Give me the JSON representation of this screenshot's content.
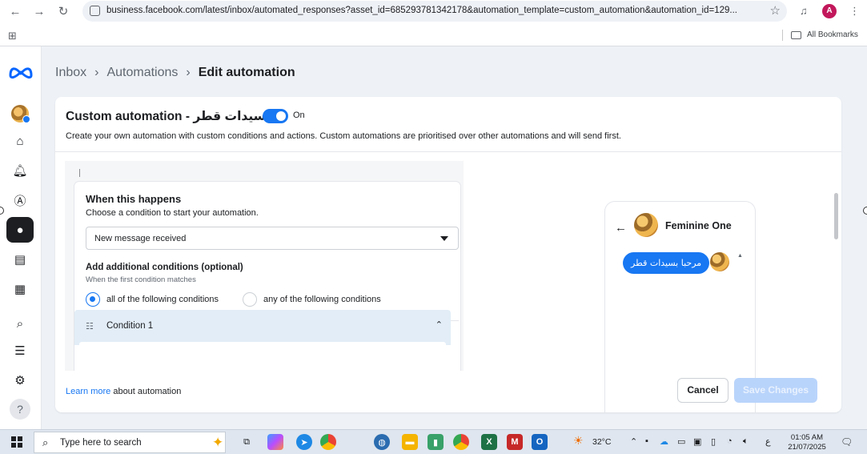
{
  "browser": {
    "url": "business.facebook.com/latest/inbox/automated_responses?asset_id=685293781342178&automation_template=custom_automation&automation_id=129...",
    "avatar_letter": "A",
    "bookmarks_label": "All Bookmarks"
  },
  "breadcrumb": {
    "inbox": "Inbox",
    "automations": "Automations",
    "current": "Edit automation"
  },
  "automation": {
    "title": "Custom automation - سيدات قطر",
    "toggle_state": "On",
    "description": "Create your own automation with custom conditions and actions. Custom automations are prioritised over other automations and will send first."
  },
  "trigger": {
    "title": "When this happens",
    "subtitle": "Choose a condition to start your automation.",
    "selected_condition": "New message received"
  },
  "additional_conditions": {
    "title": "Add additional conditions (optional)",
    "subtitle": "When the first condition matches",
    "options": [
      {
        "label": "all of the following conditions",
        "selected": true
      },
      {
        "label": "any of the following conditions",
        "selected": false
      }
    ],
    "condition_label": "Condition 1"
  },
  "preview": {
    "page_name": "Feminine One",
    "message": "مرحبا بسيدات قطر"
  },
  "footer": {
    "learn_more": "Learn more",
    "learn_suffix": "about automation",
    "cancel": "Cancel",
    "save": "Save Changes"
  },
  "taskbar": {
    "search_placeholder": "Type here to search",
    "temperature": "32°C",
    "lang": "ع",
    "time": "01:05 AM",
    "date": "21/07/2025"
  },
  "colors": {
    "accent": "#1877f2",
    "save_disabled": "#b9d4fb"
  }
}
